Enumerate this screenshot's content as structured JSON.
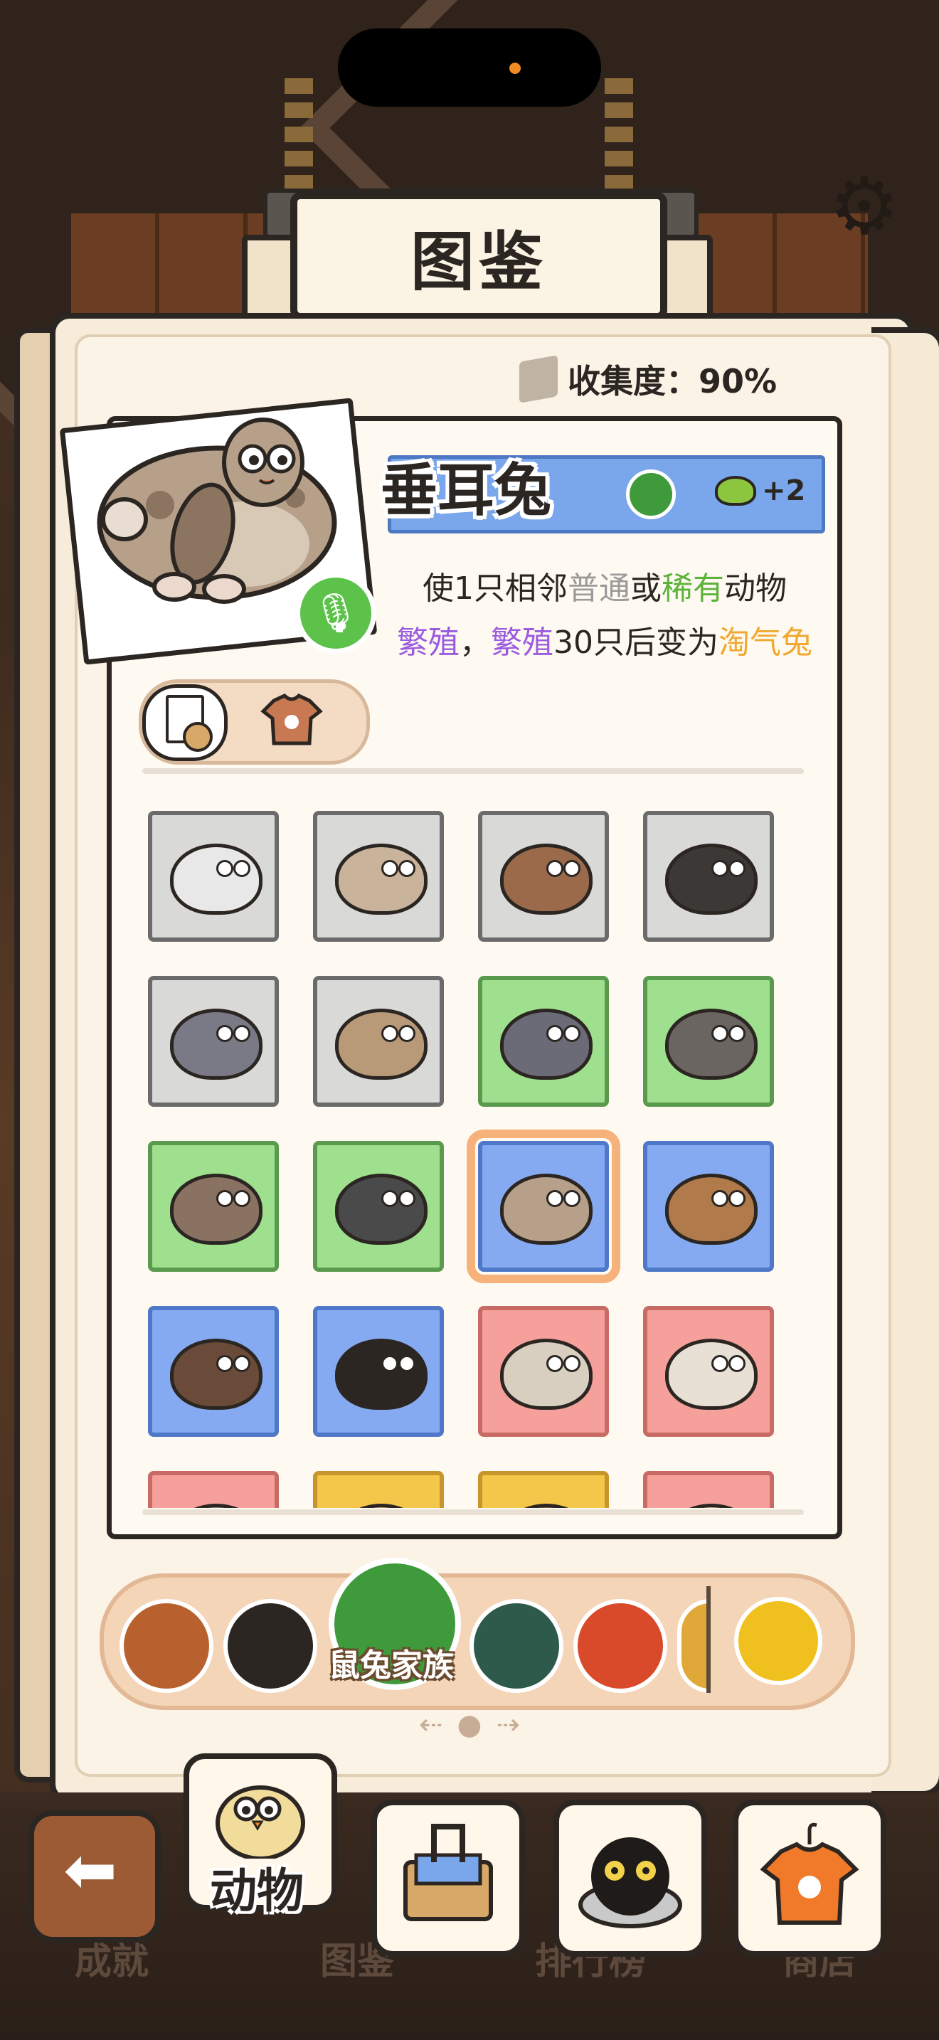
{
  "title": "图鉴",
  "collection": {
    "label": "收集度：90%"
  },
  "selected_animal": {
    "name": "垂耳兔",
    "bonus": "+2",
    "desc_parts": {
      "p1": "使1只相邻",
      "p2": "普通",
      "p3": "或",
      "p4": "稀有",
      "p5": "动物",
      "p6": "繁殖",
      "p7": "，",
      "p8": "繁殖",
      "p9": "30只后变为",
      "p10": "淘气兔"
    }
  },
  "grid": [
    {
      "rarity": "common",
      "color": "#d9d9d7"
    },
    {
      "rarity": "common",
      "color": "#d9d9d7"
    },
    {
      "rarity": "common",
      "color": "#d9d9d7"
    },
    {
      "rarity": "common",
      "color": "#d9d9d7"
    },
    {
      "rarity": "common",
      "color": "#d9d9d7"
    },
    {
      "rarity": "common",
      "color": "#d9d9d7"
    },
    {
      "rarity": "uncommon",
      "color": "#9fe08f"
    },
    {
      "rarity": "uncommon",
      "color": "#9fe08f"
    },
    {
      "rarity": "uncommon",
      "color": "#9fe08f"
    },
    {
      "rarity": "uncommon",
      "color": "#9fe08f"
    },
    {
      "rarity": "rare",
      "color": "#86aaf2",
      "selected": true
    },
    {
      "rarity": "rare",
      "color": "#86aaf2"
    },
    {
      "rarity": "rare",
      "color": "#86aaf2"
    },
    {
      "rarity": "rare",
      "color": "#86aaf2"
    },
    {
      "rarity": "epic",
      "color": "#f5a09a"
    },
    {
      "rarity": "epic",
      "color": "#f5a09a"
    },
    {
      "rarity": "epic",
      "color": "#f5a09a"
    },
    {
      "rarity": "legendary",
      "color": "#f4c64a"
    },
    {
      "rarity": "legendary",
      "color": "#f4c64a"
    },
    {
      "rarity": "epic",
      "color": "#f5a09a"
    }
  ],
  "category": {
    "active_label": "鼠兔家族",
    "icons": [
      "bird-icon",
      "cat-face-icon",
      "rodent-icon",
      "paw-print-icon",
      "fox-icon",
      "paw-icon"
    ]
  },
  "nav": {
    "items": [
      {
        "label": "成就"
      },
      {
        "label": "动物"
      },
      {
        "label": "图鉴"
      },
      {
        "label": "排行榜"
      },
      {
        "label": "商店"
      }
    ]
  },
  "colors": {
    "accent_green": "#5db33a",
    "accent_purple": "#9b5be0",
    "accent_orange": "#f0a830",
    "banner_blue": "#7aa6ec"
  }
}
